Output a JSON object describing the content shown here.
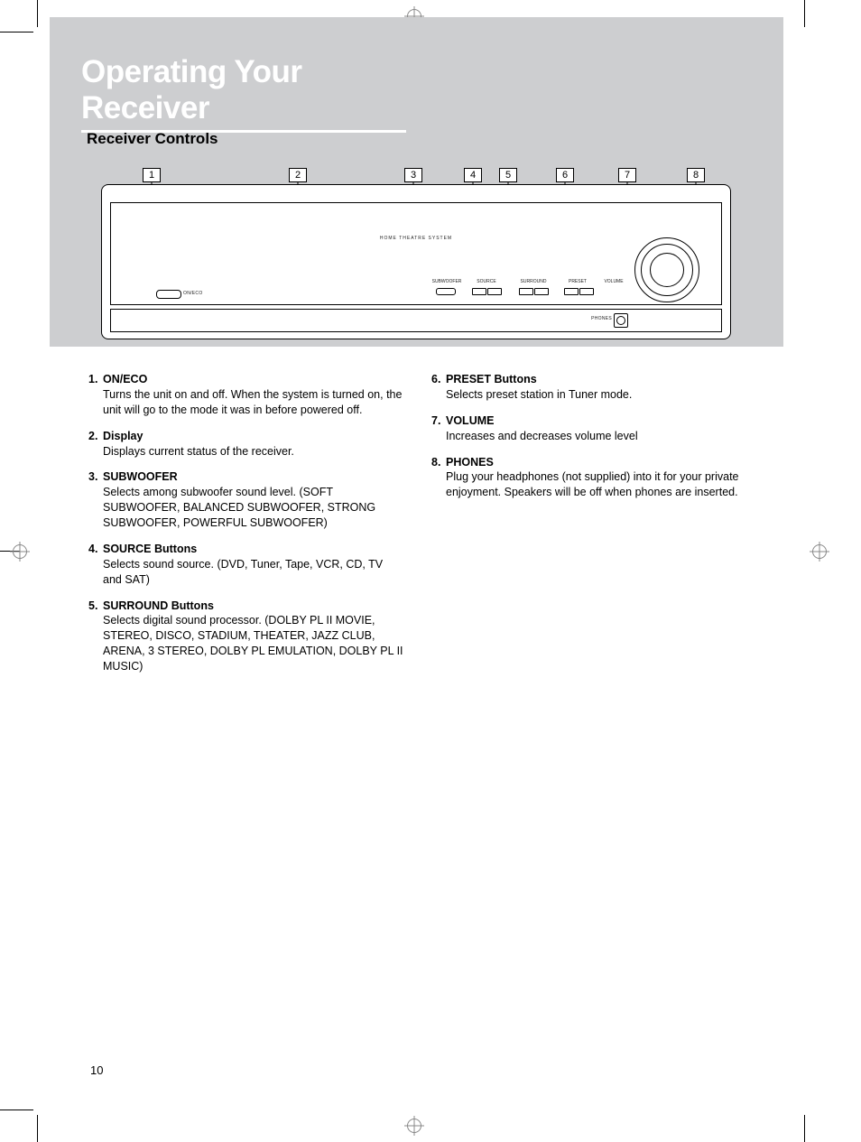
{
  "title": "Operating Your Receiver",
  "subtitle": "Receiver Controls",
  "page_number": "10",
  "diagram": {
    "center_text": "HOME THEATRE SYSTEM",
    "on_eco_label": "ON/ECO",
    "controls": {
      "subwoofer": "SUBWOOFER",
      "source": "SOURCE",
      "surround": "SURROUND",
      "preset": "PRESET",
      "volume": "VOLUME"
    },
    "phones_label": "PHONES"
  },
  "callouts": [
    "1",
    "2",
    "3",
    "4",
    "5",
    "6",
    "7",
    "8"
  ],
  "items_left": [
    {
      "num": "1.",
      "title": "ON/ECO",
      "desc": "Turns the unit on and off. When the system is turned on, the unit will go to the mode it was in before powered off."
    },
    {
      "num": "2.",
      "title": "Display",
      "desc": "Displays current status of the receiver."
    },
    {
      "num": "3.",
      "title": "SUBWOOFER",
      "desc": "Selects among subwoofer sound level. (SOFT SUBWOOFER, BALANCED SUBWOOFER, STRONG SUBWOOFER, POWERFUL SUBWOOFER)"
    },
    {
      "num": "4.",
      "title": "SOURCE Buttons",
      "desc": "Selects sound source. (DVD, Tuner, Tape, VCR, CD, TV and SAT)"
    },
    {
      "num": "5.",
      "title": "SURROUND Buttons",
      "desc": "Selects digital sound processor. (DOLBY PL II MOVIE, STEREO, DISCO, STADIUM, THEATER, JAZZ CLUB, ARENA, 3 STEREO, DOLBY PL EMULATION, DOLBY PL II MUSIC)"
    }
  ],
  "items_right": [
    {
      "num": "6.",
      "title": "PRESET Buttons",
      "desc": "Selects preset station in Tuner mode."
    },
    {
      "num": "7.",
      "title": "VOLUME",
      "desc": "Increases and decreases volume level"
    },
    {
      "num": "8.",
      "title": "PHONES",
      "desc": "Plug your headphones (not supplied) into it  for your private enjoyment. Speakers will be off when phones are inserted."
    }
  ]
}
